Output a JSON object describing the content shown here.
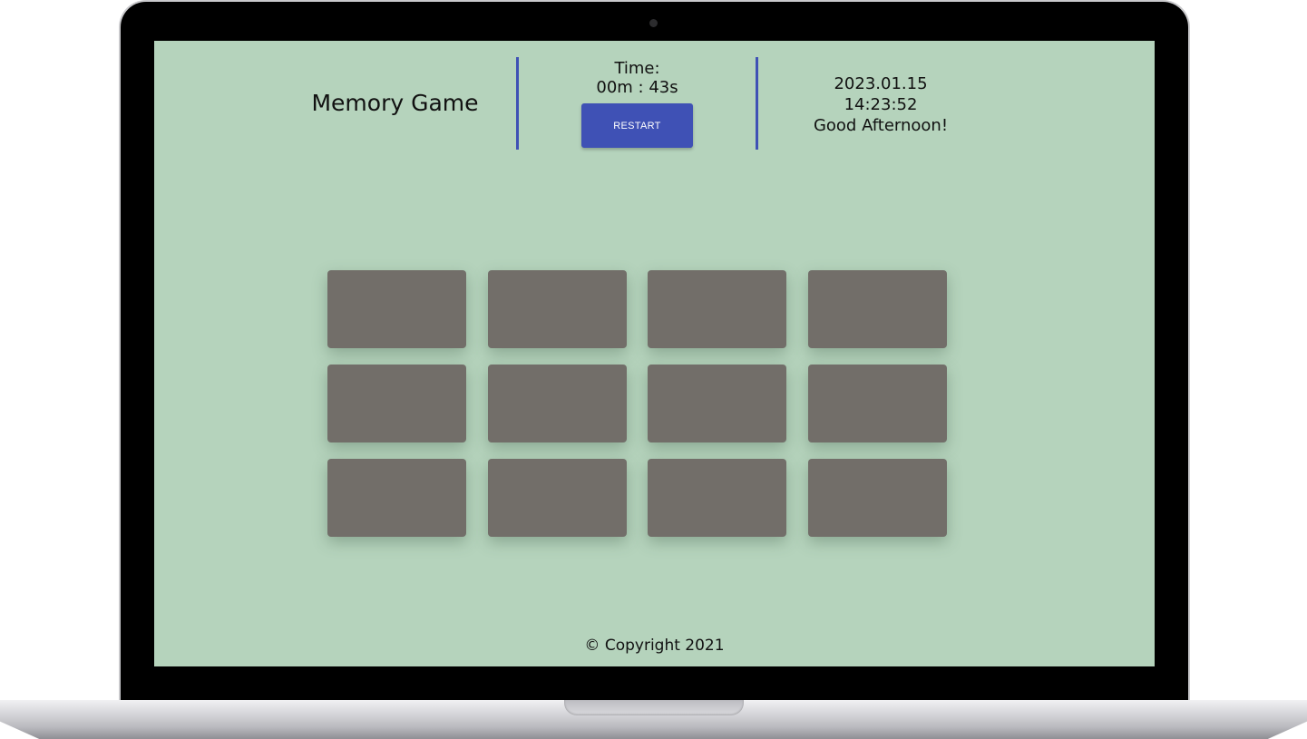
{
  "header": {
    "title": "Memory Game",
    "time_label": "Time:",
    "time_value": "00m : 43s",
    "restart_label": "RESTART",
    "date": "2023.01.15",
    "clock": "14:23:52",
    "greeting": "Good Afternoon!"
  },
  "board": {
    "rows": 3,
    "columns": 4,
    "card_state": "face-down",
    "card_color": "#726e69"
  },
  "footer": {
    "copyright": "© Copyright 2021"
  },
  "colors": {
    "background": "#b5d3bc",
    "accent": "#3f51b5",
    "card": "#726e69"
  }
}
